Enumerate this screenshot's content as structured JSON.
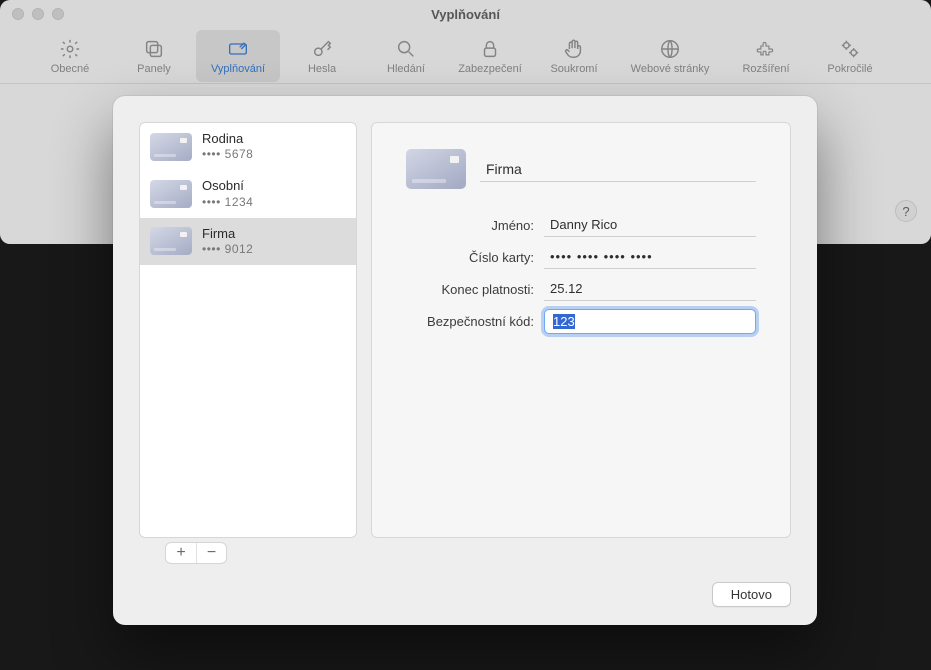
{
  "window": {
    "title": "Vyplňování"
  },
  "toolbar": {
    "items": [
      {
        "label": "Obecné"
      },
      {
        "label": "Panely"
      },
      {
        "label": "Vyplňování"
      },
      {
        "label": "Hesla"
      },
      {
        "label": "Hledání"
      },
      {
        "label": "Zabezpečení"
      },
      {
        "label": "Soukromí"
      },
      {
        "label": "Webové stránky"
      },
      {
        "label": "Rozšíření"
      },
      {
        "label": "Pokročilé"
      }
    ],
    "active_index": 2
  },
  "help": "?",
  "cards": [
    {
      "name": "Rodina",
      "digits": "•••• 5678",
      "selected": false
    },
    {
      "name": "Osobní",
      "digits": "•••• 1234",
      "selected": false
    },
    {
      "name": "Firma",
      "digits": "•••• 9012",
      "selected": true
    }
  ],
  "add_remove": {
    "add": "+",
    "remove": "−"
  },
  "detail": {
    "title_value": "Firma",
    "fields": {
      "name": {
        "label": "Jméno:",
        "value": "Danny Rico"
      },
      "number": {
        "label": "Číslo karty:",
        "value": "•••• •••• •••• ••••"
      },
      "expiry": {
        "label": "Konec platnosti:",
        "value": "25.12"
      },
      "security": {
        "label": "Bezpečnostní kód:",
        "value": "123"
      }
    }
  },
  "buttons": {
    "done": "Hotovo"
  }
}
